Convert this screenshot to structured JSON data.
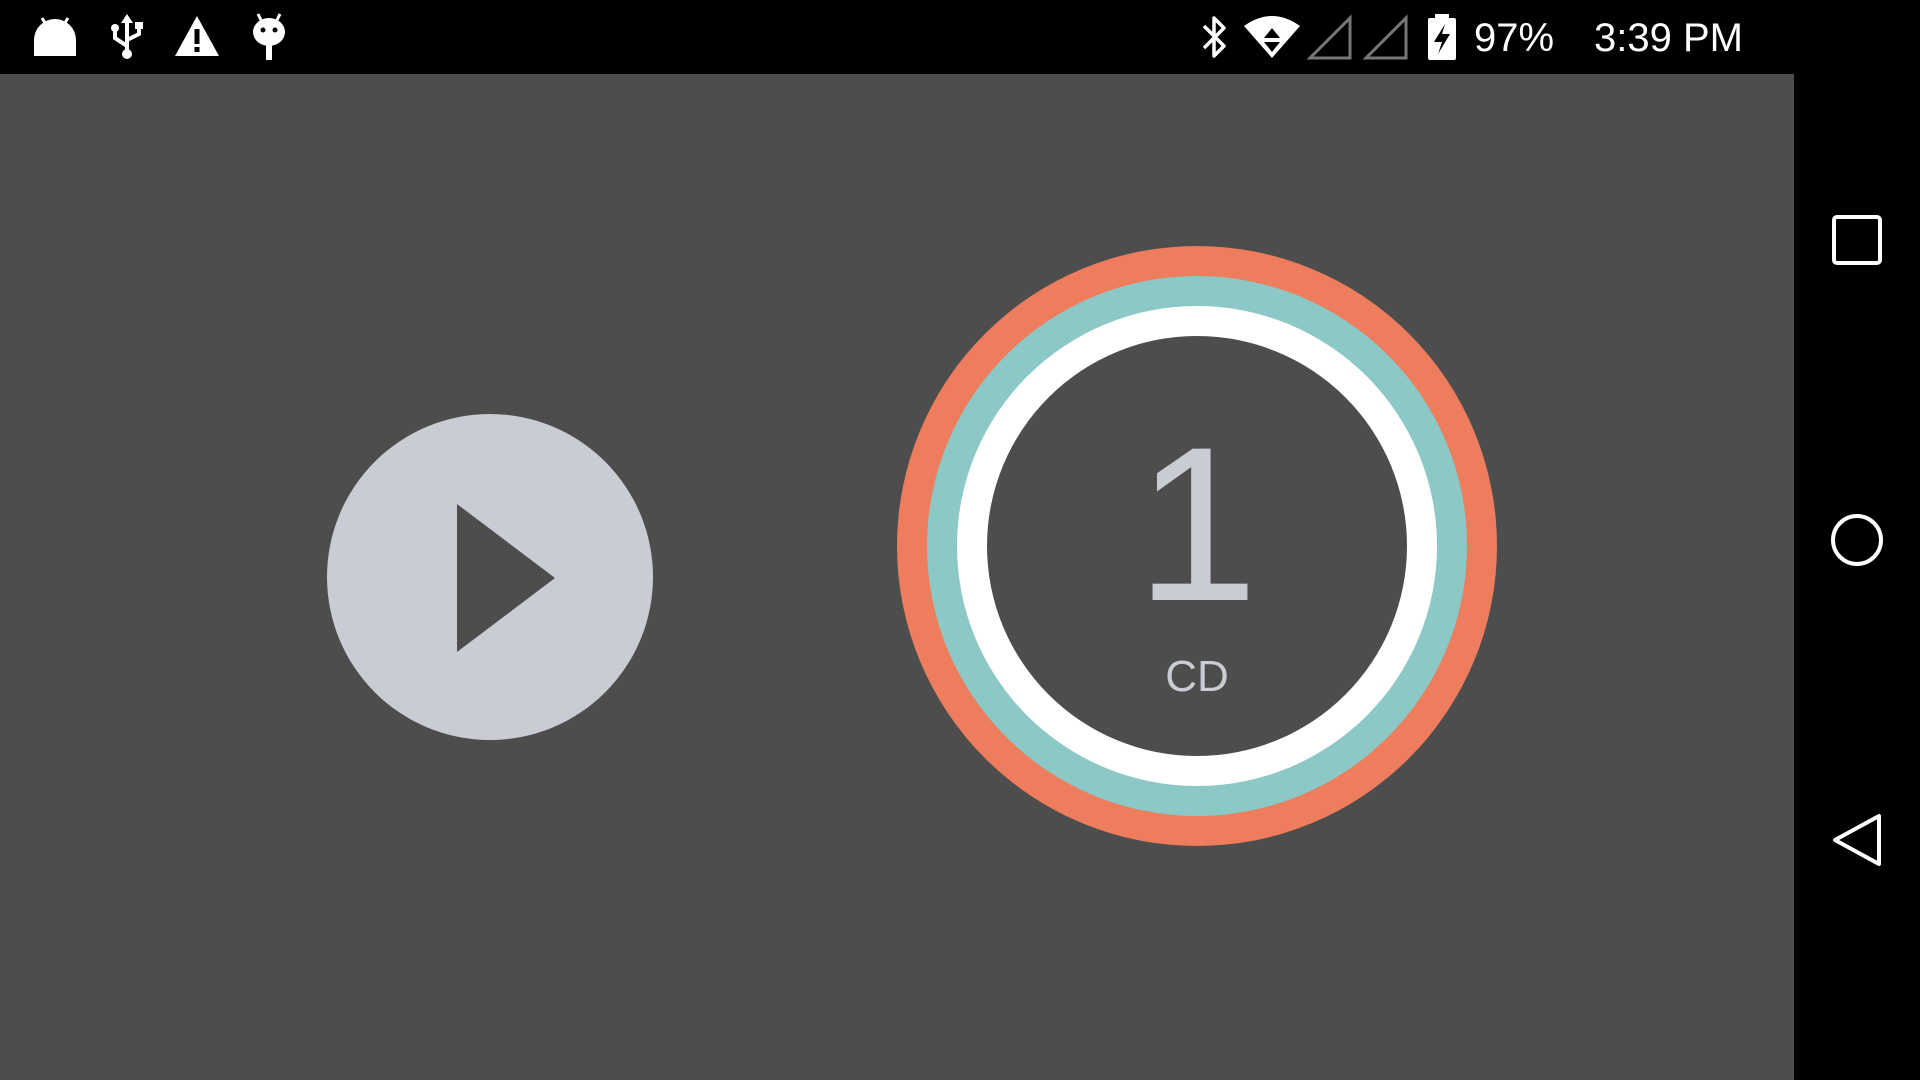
{
  "status_bar": {
    "notification_icons": [
      "android-icon",
      "usb-icon",
      "warning-icon",
      "debug-icon"
    ],
    "system_icons": [
      "bluetooth-icon",
      "wifi-icon",
      "signal-icon",
      "signal-icon",
      "battery-charging-icon"
    ],
    "battery_percent": "97%",
    "time": "3:39 PM"
  },
  "main": {
    "play_button_icon": "play-icon",
    "timer": {
      "value": "1",
      "unit": "CD",
      "ring_colors": [
        "#ed7d5c",
        "#8cc8c5",
        "#ffffff"
      ]
    }
  },
  "nav_bar": {
    "buttons": [
      "recents-icon",
      "home-icon",
      "back-icon"
    ]
  },
  "colors": {
    "background": "#4d4d4d",
    "button_fill": "#c9ccd3"
  }
}
